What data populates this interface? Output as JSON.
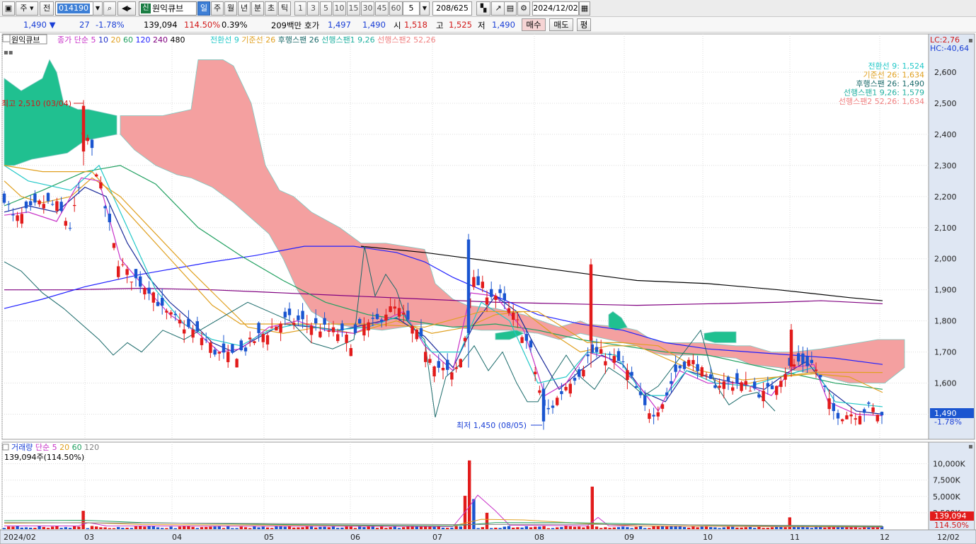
{
  "toolbar": {
    "period_dropdown": "주",
    "prev_label": "전",
    "stock_code": "014190",
    "new_badge": "신",
    "stock_name": "원익큐브",
    "periods": [
      "일",
      "주",
      "월",
      "년",
      "분",
      "초",
      "틱"
    ],
    "selected_period": "일",
    "numbers": [
      "1",
      "3",
      "5",
      "10",
      "15",
      "30",
      "45",
      "60"
    ],
    "interval_value": "5",
    "range_counter": "208/625",
    "date_value": "2024/12/02"
  },
  "quote": {
    "price": "1,490",
    "change_arrow": "▼",
    "change": "27",
    "change_rate": "-1.78%",
    "volume": "139,094",
    "volume_ratio": "114.50%",
    "turnover_rate": "0.39%",
    "amount": "209백만",
    "hoga_label": "호가",
    "ask": "1,497",
    "bid": "1,490",
    "open_label": "시",
    "open": "1,518",
    "high_label": "고",
    "high": "1,525",
    "low_label": "저",
    "low": "1,490",
    "buy_label": "매수",
    "sell_label": "매도",
    "eval_label": "평"
  },
  "legend_price": {
    "name": "원익큐브",
    "ma_label": "종가 단순",
    "ma_periods": [
      "5",
      "10",
      "20",
      "60",
      "120",
      "240",
      "480"
    ],
    "ma_colors": [
      "#c832c8",
      "#2030c8",
      "#e0a020",
      "#20a060",
      "#2020ff",
      "#800080",
      "#000000"
    ],
    "ichimoku": [
      "전환선 9",
      "기준선 26",
      "후행스팬 26",
      "선행스팬1 9,26",
      "선행스팬2 52,26"
    ],
    "ichimoku_colors": [
      "#22c8c8",
      "#e0a020",
      "#1a6a6a",
      "#20b0a0",
      "#f08080"
    ]
  },
  "ichimoku_values": [
    {
      "label": "전환선 9: 1,524",
      "color": "#22c8c8"
    },
    {
      "label": "기준선 26: 1,634",
      "color": "#e0a020"
    },
    {
      "label": "후행스팬 26: 1,490",
      "color": "#1a6a6a"
    },
    {
      "label": "선행스팬1 9,26: 1,579",
      "color": "#20b0a0"
    },
    {
      "label": "선행스팬2 52,26: 1,634",
      "color": "#f08080"
    }
  ],
  "annotations": {
    "high": "최고 2,510 (03/04)",
    "low": "최저 1,450 (08/05)",
    "lc": "LC:2,76",
    "hc": "HC:-40,64"
  },
  "price_axis": [
    "2,600",
    "2,500",
    "2,400",
    "2,300",
    "2,200",
    "2,100",
    "2,000",
    "1,900",
    "1,800",
    "1,700",
    "1,600",
    "1,500"
  ],
  "price_marker": {
    "value": "1,490",
    "rate": "-1.78%"
  },
  "legend_volume": {
    "name": "거래량",
    "ma_label": "단순",
    "ma_periods": [
      "5",
      "20",
      "60",
      "120"
    ],
    "ma_colors": [
      "#c832c8",
      "#e0a020",
      "#20a060",
      "#808080"
    ],
    "value": "139,094주(114.50%)"
  },
  "volume_axis": [
    "10,000K",
    "7,500K",
    "5,000K",
    "2,500K"
  ],
  "volume_marker": {
    "value": "139,094",
    "rate": "114.50%"
  },
  "x_axis": [
    "2024/02",
    "03",
    "04",
    "05",
    "06",
    "07",
    "08",
    "09",
    "10",
    "11",
    "12",
    "12/02"
  ],
  "colors": {
    "up": "#e21b1b",
    "down": "#1a55d0",
    "cloud_bull": "#20c090",
    "cloud_bear": "#f4a0a0"
  },
  "chart_data": {
    "type": "candlestick",
    "x_unit": "month",
    "months": [
      "2024/02",
      "03",
      "04",
      "05",
      "06",
      "07",
      "08",
      "09",
      "10",
      "11",
      "12"
    ],
    "ylim": [
      1430,
      2660
    ],
    "monthly_close_approx": {
      "2024/02": 2200,
      "03": 2250,
      "04": 1800,
      "05": 1760,
      "06": 1780,
      "07": 1850,
      "08": 1650,
      "09": 1550,
      "10": 1600,
      "11": 1680,
      "12": 1490
    },
    "high": 2510,
    "low": 1450,
    "last_close": 1490,
    "ma120_approx": [
      1840,
      1900,
      1980,
      2040,
      2040,
      1980,
      1830,
      1740,
      1710,
      1690,
      1660
    ],
    "ma240_approx": [
      1900,
      1905,
      1910,
      1905,
      1895,
      1880,
      1870,
      1860,
      1860,
      1865,
      1855
    ],
    "ma480_approx": [
      null,
      null,
      null,
      null,
      2040,
      2010,
      1960,
      1930,
      1910,
      1890,
      1865
    ],
    "volume_peaks_k": {
      "03": 2800,
      "07": 10500,
      "08": 6500,
      "11": 1800,
      "12": 139
    }
  }
}
